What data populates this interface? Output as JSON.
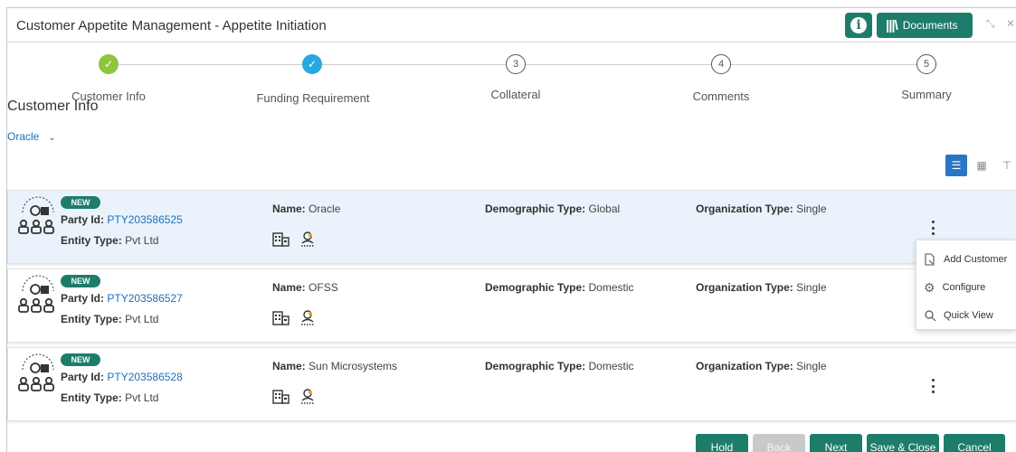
{
  "window": {
    "title": "Customer Appetite Management - Appetite Initiation",
    "documents_label": "Documents"
  },
  "steps": [
    {
      "label": "Customer Info",
      "state": "done-green",
      "number": "✓"
    },
    {
      "label": "Funding Requirement",
      "state": "done-blue",
      "number": "✓"
    },
    {
      "label": "Collateral",
      "state": "todo",
      "number": "3"
    },
    {
      "label": "Comments",
      "state": "todo",
      "number": "4"
    },
    {
      "label": "Summary",
      "state": "todo",
      "number": "5"
    }
  ],
  "section": {
    "title": "Customer Info",
    "organization": "Oracle"
  },
  "labels": {
    "party_id": "Party Id:",
    "entity_type": "Entity Type:",
    "name": "Name:",
    "demographic_type": "Demographic Type:",
    "organization_type": "Organization Type:"
  },
  "customers": [
    {
      "badge": "NEW",
      "party_id": "PTY203586525",
      "entity_type": "Pvt Ltd",
      "name": "Oracle",
      "demographic_type": "Global",
      "organization_type": "Single"
    },
    {
      "badge": "NEW",
      "party_id": "PTY203586527",
      "entity_type": "Pvt Ltd",
      "name": "OFSS",
      "demographic_type": "Domestic",
      "organization_type": "Single"
    },
    {
      "badge": "NEW",
      "party_id": "PTY203586528",
      "entity_type": "Pvt Ltd",
      "name": "Sun Microsystems",
      "demographic_type": "Domestic",
      "organization_type": "Single"
    }
  ],
  "context_menu": [
    {
      "label": "Add Customer",
      "icon": "add-document-icon"
    },
    {
      "label": "Configure",
      "icon": "gear-icon"
    },
    {
      "label": "Quick View",
      "icon": "search-icon"
    }
  ],
  "footer": {
    "hold": "Hold",
    "back": "Back",
    "next": "Next",
    "save_close": "Save & Close",
    "cancel": "Cancel"
  },
  "colors": {
    "primary": "#1d7d6a",
    "link": "#1d6fb8",
    "step_done_green": "#8cc63f",
    "step_done_blue": "#29a8e0",
    "selected_row": "#eaf3fb"
  }
}
